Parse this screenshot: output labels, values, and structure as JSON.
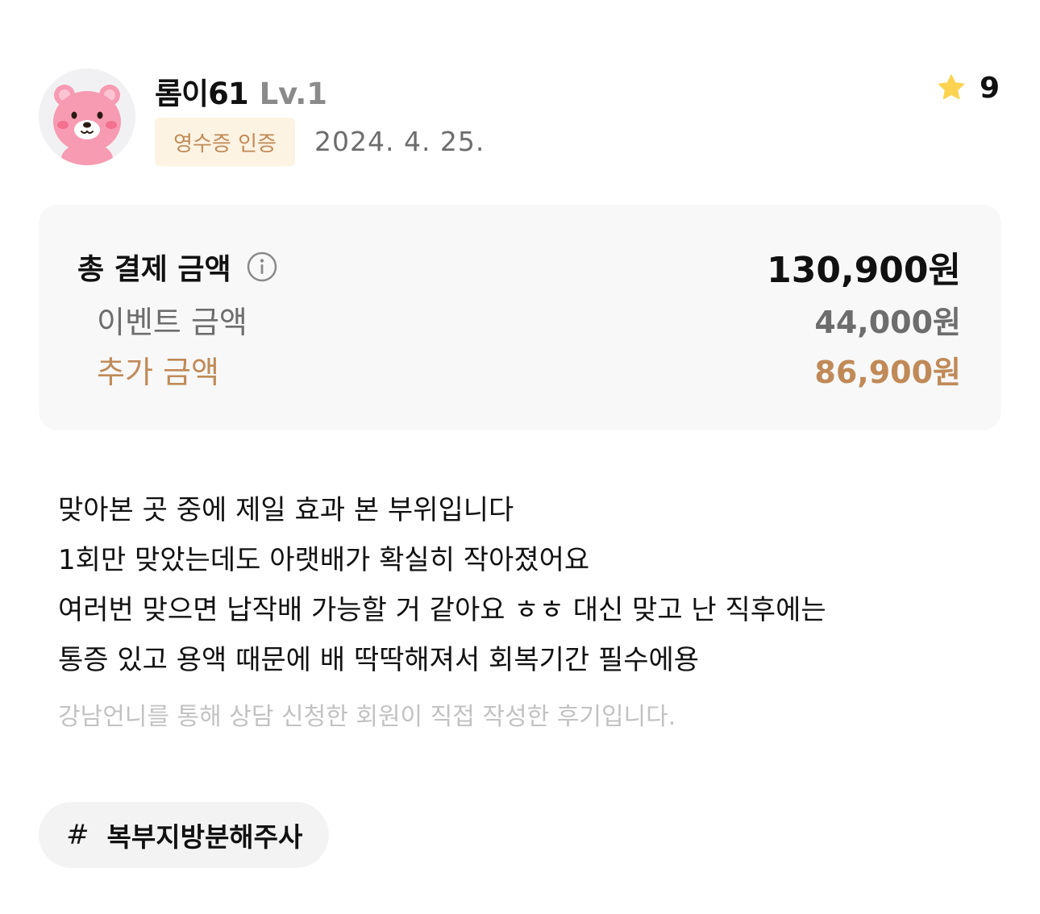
{
  "reviewer": {
    "name": "롬이61",
    "level": "Lv.1",
    "avatar_icon": "pink-bear-avatar-icon"
  },
  "verification_badge": "영수증 인증",
  "date": "2024. 4. 25.",
  "rating": {
    "icon": "star-icon",
    "value": "9"
  },
  "price_summary": {
    "total_label": "총 결제 금액",
    "total_value": "130,900원",
    "event_label": "이벤트 금액",
    "event_value": "44,000원",
    "extra_label": "추가 금액",
    "extra_value": "86,900원",
    "info_icon": "info-icon"
  },
  "review_lines": [
    "맞아본 곳 중에 제일 효과 본 부위입니다",
    "1회만 맞았는데도 아랫배가 확실히 작아졌어요",
    "여러번 맞으면 납작배 가능할 거 같아요 ㅎㅎ 대신 맞고 난 직후에는",
    "통증 있고 용액 때문에 배 딱딱해져서 회복기간 필수에용"
  ],
  "disclaimer": "강남언니를 통해 상담 신청한 회원이 직접 작성한 후기입니다.",
  "tag": {
    "hash": "#",
    "label": "복부지방분해주사"
  },
  "colors": {
    "accent_brown": "#c08a58",
    "badge_bg": "#fdf3e2",
    "star": "#fdd451",
    "muted_text": "#6d6d6d",
    "box_bg": "#f8f8f8"
  }
}
